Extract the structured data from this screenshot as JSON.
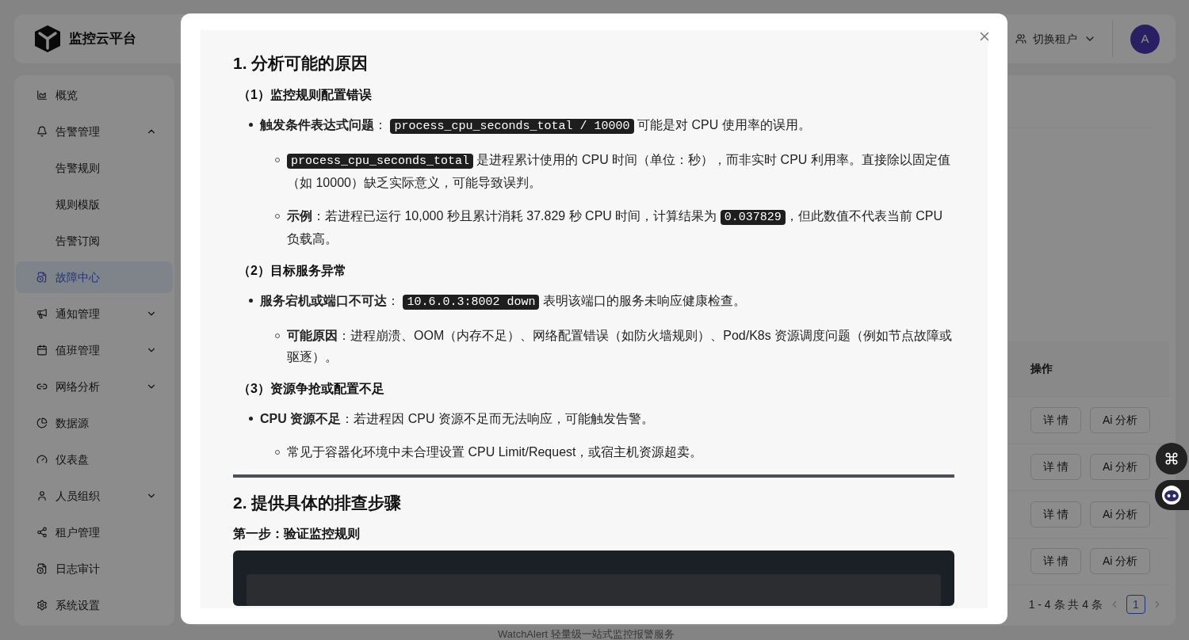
{
  "app": {
    "logo_text": "监控云平台"
  },
  "header": {
    "tenant_switch": "切换租户",
    "avatar": "A"
  },
  "sidebar": {
    "items": [
      {
        "label": "概览",
        "kind": "chart",
        "selected": false
      },
      {
        "label": "告警管理",
        "kind": "bell",
        "selected": false,
        "expanded": true,
        "children": [
          {
            "label": "告警规则",
            "selected": false
          },
          {
            "label": "规则模版",
            "selected": false
          },
          {
            "label": "告警订阅",
            "selected": false
          }
        ]
      },
      {
        "label": "故障中心",
        "kind": "doc",
        "selected": true
      },
      {
        "label": "通知管理",
        "kind": "megaphone",
        "selected": false,
        "expanded": false
      },
      {
        "label": "值班管理",
        "kind": "calendar",
        "selected": false,
        "expanded": false
      },
      {
        "label": "网络分析",
        "kind": "link",
        "selected": false,
        "expanded": false
      },
      {
        "label": "数据源",
        "kind": "pie",
        "selected": false
      },
      {
        "label": "仪表盘",
        "kind": "gauge",
        "selected": false
      },
      {
        "label": "人员组织",
        "kind": "user",
        "selected": false,
        "expanded": false
      },
      {
        "label": "租户管理",
        "kind": "share",
        "selected": false
      },
      {
        "label": "日志审计",
        "kind": "doc",
        "selected": false
      },
      {
        "label": "系统设置",
        "kind": "gear",
        "selected": false
      }
    ]
  },
  "table": {
    "columns": [
      "操作"
    ],
    "rows": [
      {
        "actions": [
          "详 情",
          "Ai 分析"
        ]
      },
      {
        "actions": [
          "详 情",
          "Ai 分析"
        ]
      },
      {
        "actions": [
          "详 情",
          "Ai 分析"
        ]
      },
      {
        "actions": [
          "详 情",
          "Ai 分析"
        ]
      }
    ]
  },
  "pagination": {
    "summary": "1 - 4 条 共 4 条",
    "pages": [
      {
        "label": "1",
        "selected": true
      }
    ]
  },
  "footer": "WatchAlert 轻量级一站式监控报警服务",
  "dialog": {
    "blocks": [
      {
        "kind": "h2",
        "text": "1. 分析可能的原因"
      },
      {
        "kind": "h3",
        "text": "（1）监控规则配置错误"
      },
      {
        "kind": "bullet",
        "segments": [
          {
            "kind": "bold",
            "text": "触发条件表达式问题"
          },
          {
            "kind": "text",
            "text": "： "
          },
          {
            "kind": "code",
            "text": "process_cpu_seconds_total / 10000"
          },
          {
            "kind": "text",
            "text": " 可能是对 CPU 使用率的误用。"
          }
        ]
      },
      {
        "kind": "sub_bullet",
        "segments": [
          {
            "kind": "code",
            "text": "process_cpu_seconds_total"
          },
          {
            "kind": "text",
            "text": " 是进程累计使用的 CPU 时间（单位：秒），而非实时 CPU 利用率。直接除以固定值（如 10000）缺乏实际意义，可能导致误判。"
          }
        ]
      },
      {
        "kind": "sub_bullet",
        "segments": [
          {
            "kind": "bold",
            "text": "示例"
          },
          {
            "kind": "text",
            "text": "：若进程已运行 10,000 秒且累计消耗 37.829 秒 CPU 时间，计算结果为 "
          },
          {
            "kind": "code",
            "text": "0.037829"
          },
          {
            "kind": "text",
            "text": "，但此数值不代表当前 CPU 负载高。"
          }
        ]
      },
      {
        "kind": "h3",
        "text": "（2）目标服务异常"
      },
      {
        "kind": "bullet",
        "segments": [
          {
            "kind": "bold",
            "text": "服务宕机或端口不可达"
          },
          {
            "kind": "text",
            "text": "： "
          },
          {
            "kind": "code",
            "text": "10.6.0.3:8002 down"
          },
          {
            "kind": "text",
            "text": " 表明该端口的服务未响应健康检查。"
          }
        ]
      },
      {
        "kind": "sub_bullet",
        "segments": [
          {
            "kind": "bold",
            "text": "可能原因"
          },
          {
            "kind": "text",
            "text": "：进程崩溃、OOM（内存不足）、网络配置错误（如防火墙规则）、Pod/K8s 资源调度问题（例如节点故障或驱逐）。"
          }
        ]
      },
      {
        "kind": "h3",
        "text": "（3）资源争抢或配置不足"
      },
      {
        "kind": "bullet",
        "segments": [
          {
            "kind": "bold",
            "text": "CPU 资源不足"
          },
          {
            "kind": "text",
            "text": "：若进程因 CPU 资源不足而无法响应，可能触发告警。"
          }
        ]
      },
      {
        "kind": "sub_bullet",
        "segments": [
          {
            "kind": "text",
            "text": "常见于容器化环境中未合理设置 CPU Limit/Request，或宿主机资源超卖。"
          }
        ]
      },
      {
        "kind": "divider"
      },
      {
        "kind": "h2",
        "text": "2. 提供具体的排查步骤"
      },
      {
        "kind": "h4",
        "text": "第一步：验证监控规则"
      },
      {
        "kind": "code_block"
      }
    ]
  }
}
